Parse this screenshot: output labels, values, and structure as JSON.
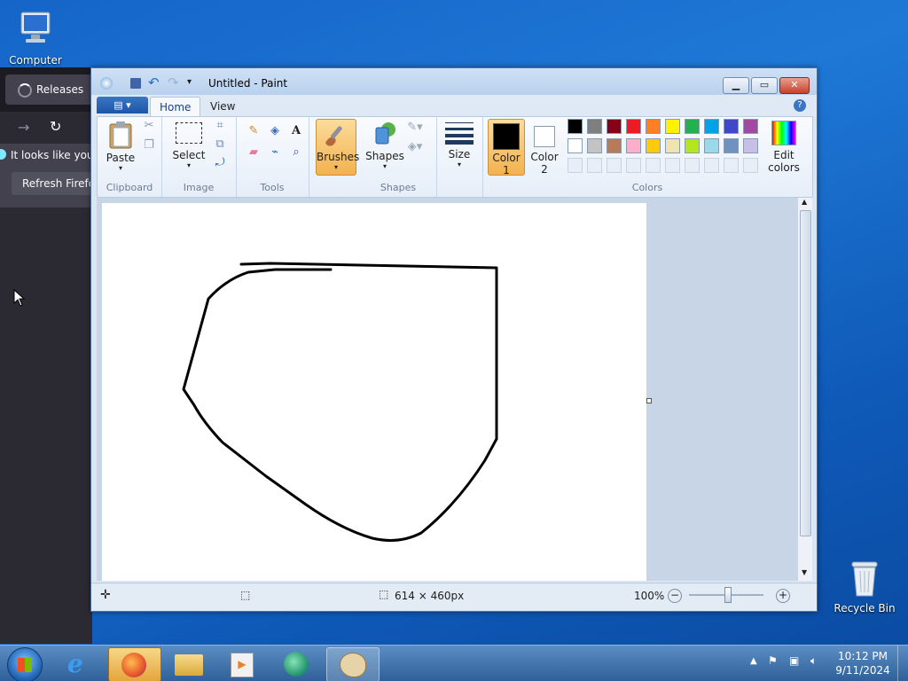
{
  "desktop": {
    "icons": [
      {
        "label": "Computer"
      },
      {
        "label": "Recycle Bin"
      }
    ]
  },
  "browser_bg": {
    "tab_title": "Releases",
    "notice_text": "It looks like you h",
    "refresh_button": "Refresh Firefox"
  },
  "paint": {
    "title": "Untitled - Paint",
    "tabs": [
      "Home",
      "View"
    ],
    "ribbon": {
      "clipboard": {
        "group": "Clipboard",
        "paste": "Paste"
      },
      "image": {
        "group": "Image",
        "select": "Select"
      },
      "tools": {
        "group": "Tools"
      },
      "brushes": {
        "label": "Brushes"
      },
      "shapes": {
        "group": "Shapes",
        "label": "Shapes"
      },
      "size": {
        "label": "Size"
      },
      "colors": {
        "group": "Colors",
        "color1": "Color\n1",
        "color1_a": "Color",
        "color1_b": "1",
        "color2_a": "Color",
        "color2_b": "2",
        "edit_a": "Edit",
        "edit_b": "colors",
        "color1_value": "#000000",
        "color2_value": "#ffffff",
        "palette_row1": [
          "#000000",
          "#7f7f7f",
          "#880015",
          "#ed1c24",
          "#ff7f27",
          "#fff200",
          "#22b14c",
          "#00a2e8",
          "#3f48cc",
          "#a349a4"
        ],
        "palette_row2": [
          "#ffffff",
          "#c3c3c3",
          "#b97a57",
          "#ffaec9",
          "#ffc90e",
          "#efe4b0",
          "#b5e61d",
          "#99d9ea",
          "#7092be",
          "#c8bfe7"
        ]
      }
    },
    "status": {
      "canvas_size": "614 × 460px",
      "zoom": "100%"
    }
  },
  "taskbar": {
    "time": "10:12 PM",
    "date": "9/11/2024"
  },
  "colors": {
    "accent": "#1d55a6",
    "active_tool": "#f7c56b"
  }
}
